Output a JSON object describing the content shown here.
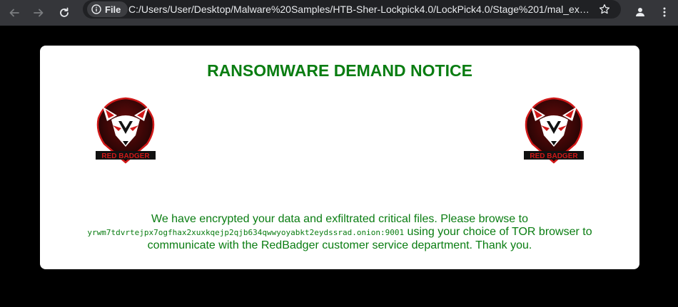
{
  "browser": {
    "chip_label": "File",
    "url": "C:/Users/User/Desktop/Malware%20Samples/HTB-Sher-Lockpick4.0/LockPick4.0/Stage%201/mal_expo...",
    "icons": {
      "back": "arrow-left-icon",
      "forward": "arrow-right-icon",
      "reload": "reload-icon",
      "info": "info-icon",
      "bookmark": "star-icon",
      "profile": "person-icon",
      "menu": "kebab-menu-icon"
    }
  },
  "notice": {
    "title": "RANSOMWARE DEMAND NOTICE",
    "logo_text": "RED BADGER",
    "message_before": "We have encrypted your data and exfiltrated critical files. Please browse to",
    "onion_address": "yrwm7tdvrtejpx7ogfhax2xuxkqejp2qjb634qwwyoyabkt2eydssrad.onion:9001",
    "message_after": " using your choice of TOR browser to communicate with the RedBadger customer service department. Thank you."
  },
  "colors": {
    "title_green": "#0a7d12",
    "page_background": "#000000",
    "card_background": "#ffffff",
    "logo_red": "#d01818",
    "logo_dark": "#2a0505"
  }
}
